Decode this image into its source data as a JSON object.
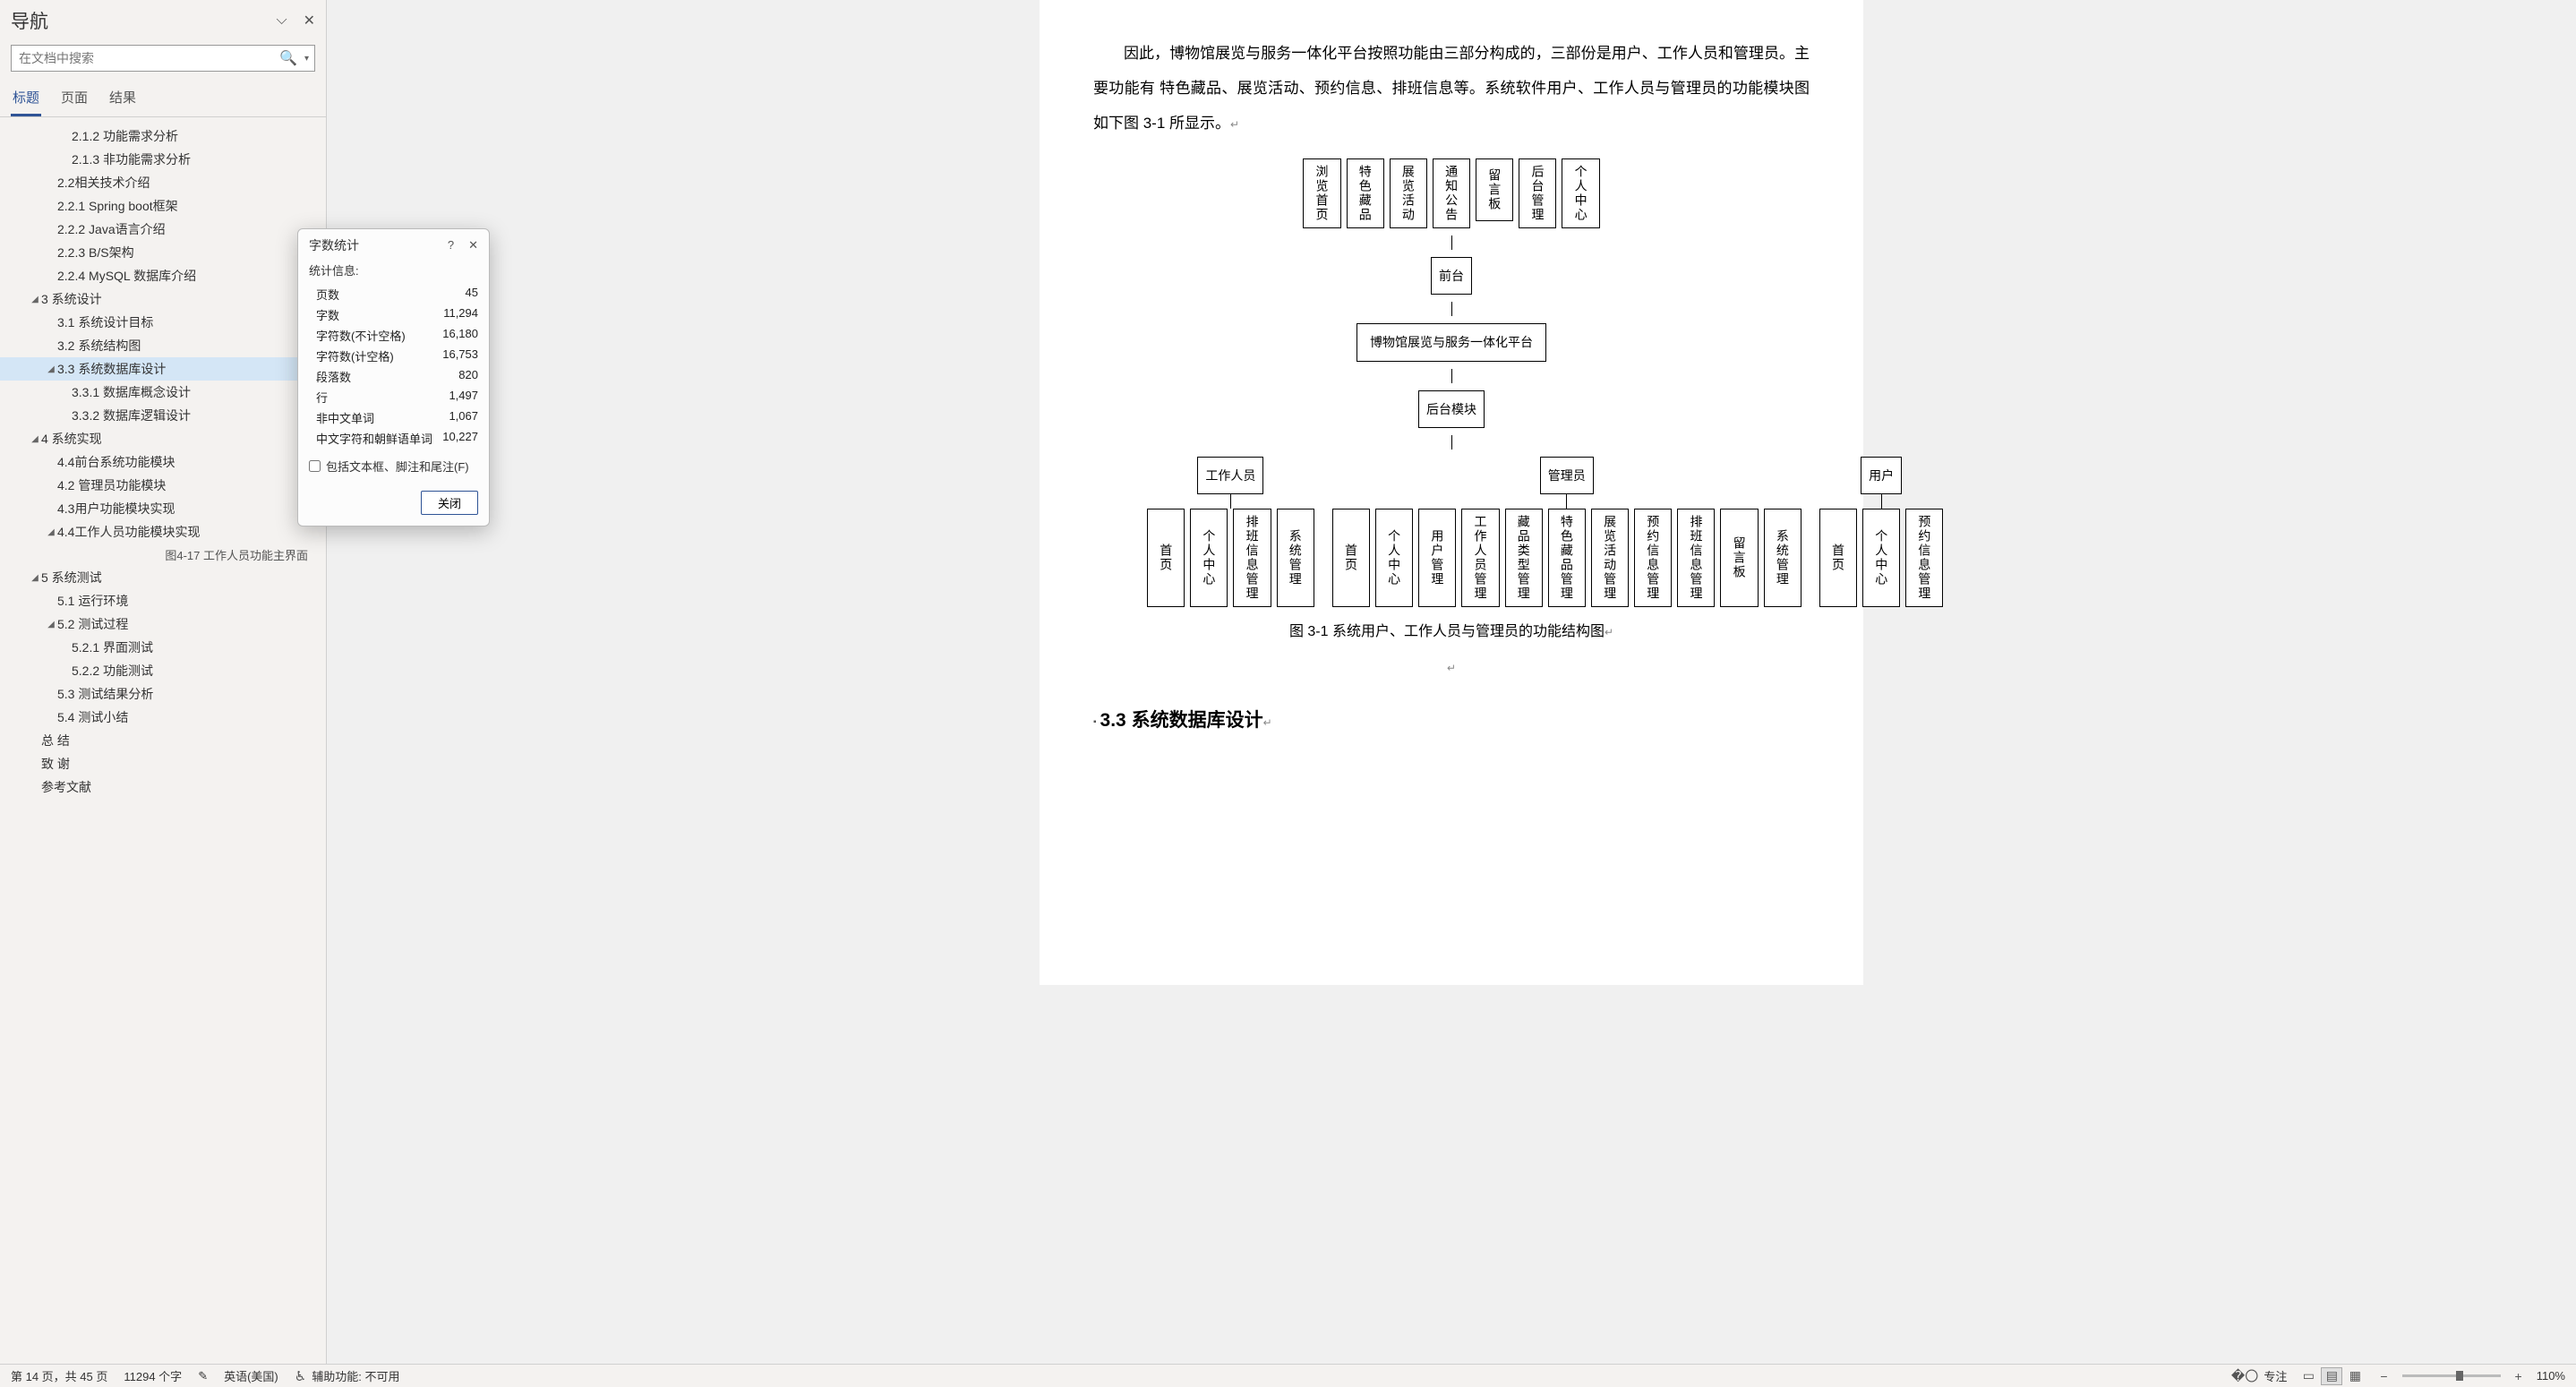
{
  "nav": {
    "title": "导航",
    "search_placeholder": "在文档中搜索",
    "tabs": [
      "标题",
      "页面",
      "结果"
    ],
    "active_tab": 0,
    "tree": [
      {
        "level": 3,
        "label": "2.1.2 功能需求分析",
        "caret": ""
      },
      {
        "level": 3,
        "label": "2.1.3 非功能需求分析",
        "caret": ""
      },
      {
        "level": 2,
        "label": "2.2相关技术介绍",
        "caret": ""
      },
      {
        "level": 2,
        "label": "2.2.1 Spring boot框架",
        "caret": ""
      },
      {
        "level": 2,
        "label": "2.2.2 Java语言介绍",
        "caret": ""
      },
      {
        "level": 2,
        "label": "2.2.3 B/S架构",
        "caret": ""
      },
      {
        "level": 2,
        "label": "2.2.4 MySQL 数据库介绍",
        "caret": ""
      },
      {
        "level": 1,
        "label": "3 系统设计",
        "caret": "◢"
      },
      {
        "level": 2,
        "label": "3.1 系统设计目标",
        "caret": ""
      },
      {
        "level": 2,
        "label": "3.2 系统结构图",
        "caret": ""
      },
      {
        "level": 2,
        "label": "3.3 系统数据库设计",
        "caret": "◢",
        "selected": true
      },
      {
        "level": 3,
        "label": "3.3.1 数据库概念设计",
        "caret": ""
      },
      {
        "level": 3,
        "label": "3.3.2 数据库逻辑设计",
        "caret": ""
      },
      {
        "level": 1,
        "label": "4 系统实现",
        "caret": "◢"
      },
      {
        "level": 2,
        "label": "4.4前台系统功能模块",
        "caret": ""
      },
      {
        "level": 2,
        "label": "4.2 管理员功能模块",
        "caret": ""
      },
      {
        "level": 2,
        "label": "4.3用户功能模块实现",
        "caret": ""
      },
      {
        "level": 2,
        "label": "4.4工作人员功能模块实现",
        "caret": "◢"
      },
      {
        "level": 3,
        "label": "图4-17 工作人员功能主界面",
        "caret": "",
        "right": true
      },
      {
        "level": 1,
        "label": "5 系统测试",
        "caret": "◢"
      },
      {
        "level": 2,
        "label": "5.1 运行环境",
        "caret": ""
      },
      {
        "level": 2,
        "label": "5.2 测试过程",
        "caret": "◢"
      },
      {
        "level": 3,
        "label": "5.2.1 界面测试",
        "caret": ""
      },
      {
        "level": 3,
        "label": "5.2.2 功能测试",
        "caret": ""
      },
      {
        "level": 2,
        "label": "5.3 测试结果分析",
        "caret": ""
      },
      {
        "level": 2,
        "label": "5.4 测试小结",
        "caret": ""
      },
      {
        "level": 1,
        "label": "总 结",
        "caret": ""
      },
      {
        "level": 1,
        "label": "致 谢",
        "caret": ""
      },
      {
        "level": 1,
        "label": "参考文献",
        "caret": ""
      }
    ]
  },
  "doc": {
    "paragraph": "因此，博物馆展览与服务一体化平台按照功能由三部分构成的，三部份是用户、工作人员和管理员。主要功能有 特色藏品、展览活动、预约信息、排班信息等。系统软件用户、工作人员与管理员的功能模块图如下图 3-1 所显示。",
    "caption": "图 3-1 系统用户、工作人员与管理员的功能结构图",
    "heading": "3.3 系统数据库设计"
  },
  "diagram": {
    "top_row": [
      "浏览首页",
      "特色藏品",
      "展览活动",
      "通知公告",
      "留言板",
      "后台管理",
      "个人中心"
    ],
    "frontend": "前台",
    "platform": "博物馆展览与服务一体化平台",
    "backend": "后台模块",
    "roles": [
      "工作人员",
      "管理员",
      "用户"
    ],
    "staff_children": [
      "首页",
      "个人中心",
      "排班信息管理",
      "系统管理"
    ],
    "admin_children": [
      "首页",
      "个人中心",
      "用户管理",
      "工作人员管理",
      "藏品类型管理",
      "特色藏品管理",
      "展览活动管理",
      "预约信息管理",
      "排班信息管理",
      "留言板",
      "系统管理"
    ],
    "user_children": [
      "首页",
      "个人中心",
      "预约信息管理"
    ]
  },
  "dialog": {
    "title": "字数统计",
    "subtitle": "统计信息:",
    "rows": [
      {
        "label": "页数",
        "value": "45"
      },
      {
        "label": "字数",
        "value": "11,294"
      },
      {
        "label": "字符数(不计空格)",
        "value": "16,180"
      },
      {
        "label": "字符数(计空格)",
        "value": "16,753"
      },
      {
        "label": "段落数",
        "value": "820"
      },
      {
        "label": "行",
        "value": "1,497"
      },
      {
        "label": "非中文单词",
        "value": "1,067"
      },
      {
        "label": "中文字符和朝鲜语单词",
        "value": "10,227"
      }
    ],
    "checkbox_label": "包括文本框、脚注和尾注(F)",
    "close_btn": "关闭"
  },
  "status": {
    "page_info": "第 14 页，共 45 页",
    "word_count": "11294 个字",
    "language": "英语(美国)",
    "accessibility": "辅助功能: 不可用",
    "focus": "专注",
    "zoom": "110%"
  }
}
